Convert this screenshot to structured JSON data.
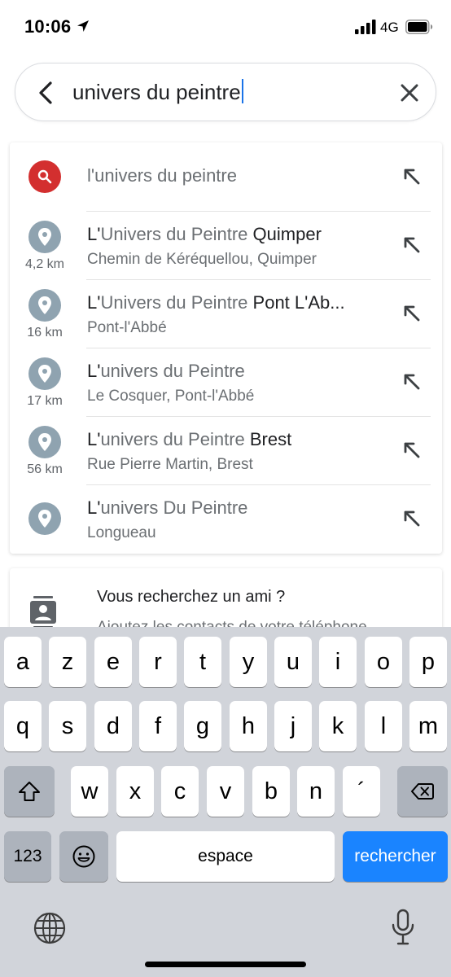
{
  "status_bar": {
    "time": "10:06",
    "network": "4G",
    "icons": [
      "location-arrow-icon",
      "signal-bars-icon",
      "battery-icon"
    ]
  },
  "search": {
    "query": "univers du peintre",
    "back_icon": "back-arrow-icon",
    "clear_icon": "close-icon"
  },
  "suggestions": [
    {
      "icon": "search-icon",
      "prefix": "l'",
      "match": "univers du peintre",
      "suffix": "",
      "subtitle": "",
      "distance": ""
    },
    {
      "icon": "place-pin-icon",
      "prefix": "L'",
      "match": "Univers du Peintre",
      "suffix": " Quimper",
      "subtitle": "Chemin de Kéréquellou, Quimper",
      "distance": "4,2 km"
    },
    {
      "icon": "place-pin-icon",
      "prefix": "L'",
      "match": "Univers du Peintre",
      "suffix": " Pont L'Ab...",
      "subtitle": "Pont-l'Abbé",
      "distance": "16 km"
    },
    {
      "icon": "place-pin-icon",
      "prefix": "L'",
      "match": "univers du Peintre",
      "suffix": "",
      "subtitle": "Le Cosquer, Pont-l'Abbé",
      "distance": "17 km"
    },
    {
      "icon": "place-pin-icon",
      "prefix": "L'",
      "match": "univers du Peintre",
      "suffix": " Brest",
      "subtitle": "Rue Pierre Martin, Brest",
      "distance": "56 km"
    },
    {
      "icon": "place-pin-icon",
      "prefix": "L'",
      "match": "univers Du Peintre",
      "suffix": "",
      "subtitle": "Longueau",
      "distance": ""
    }
  ],
  "friend_card": {
    "title": "Vous recherchez un ami ?",
    "description": "Ajoutez les contacts de votre téléphone",
    "icon": "contacts-icon"
  },
  "keyboard": {
    "row1": [
      "a",
      "z",
      "e",
      "r",
      "t",
      "y",
      "u",
      "i",
      "o",
      "p"
    ],
    "row2": [
      "q",
      "s",
      "d",
      "f",
      "g",
      "h",
      "j",
      "k",
      "l",
      "m"
    ],
    "row3": [
      "w",
      "x",
      "c",
      "v",
      "b",
      "n",
      "´"
    ],
    "numbers_label": "123",
    "space_label": "espace",
    "return_label": "rechercher"
  },
  "colors": {
    "accent": "#1a73e8",
    "search_badge": "#d32f2f",
    "pin_badge": "#8fa3b0",
    "return_key": "#1a84ff"
  }
}
